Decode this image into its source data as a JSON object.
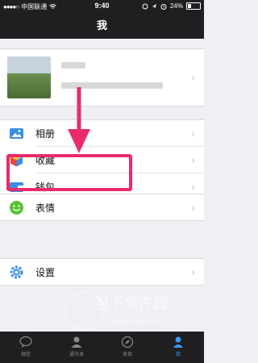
{
  "status_bar": {
    "carrier": "中国联通",
    "time": "9:40",
    "battery": "24%"
  },
  "nav": {
    "title": "我"
  },
  "menu": {
    "album": "相册",
    "favorites": "收藏",
    "wallet": "钱包",
    "stickers": "表情",
    "settings": "设置"
  },
  "tabs": [
    {
      "label": "微信"
    },
    {
      "label": "通讯录"
    },
    {
      "label": "发现"
    },
    {
      "label": "我"
    }
  ],
  "watermark": {
    "brand": "当下软件园",
    "url": "jingyan.baidu.com"
  },
  "colors": {
    "bar": "#1f1f22",
    "highlight": "#ea2b6a",
    "active_tab": "#3b9bff"
  }
}
